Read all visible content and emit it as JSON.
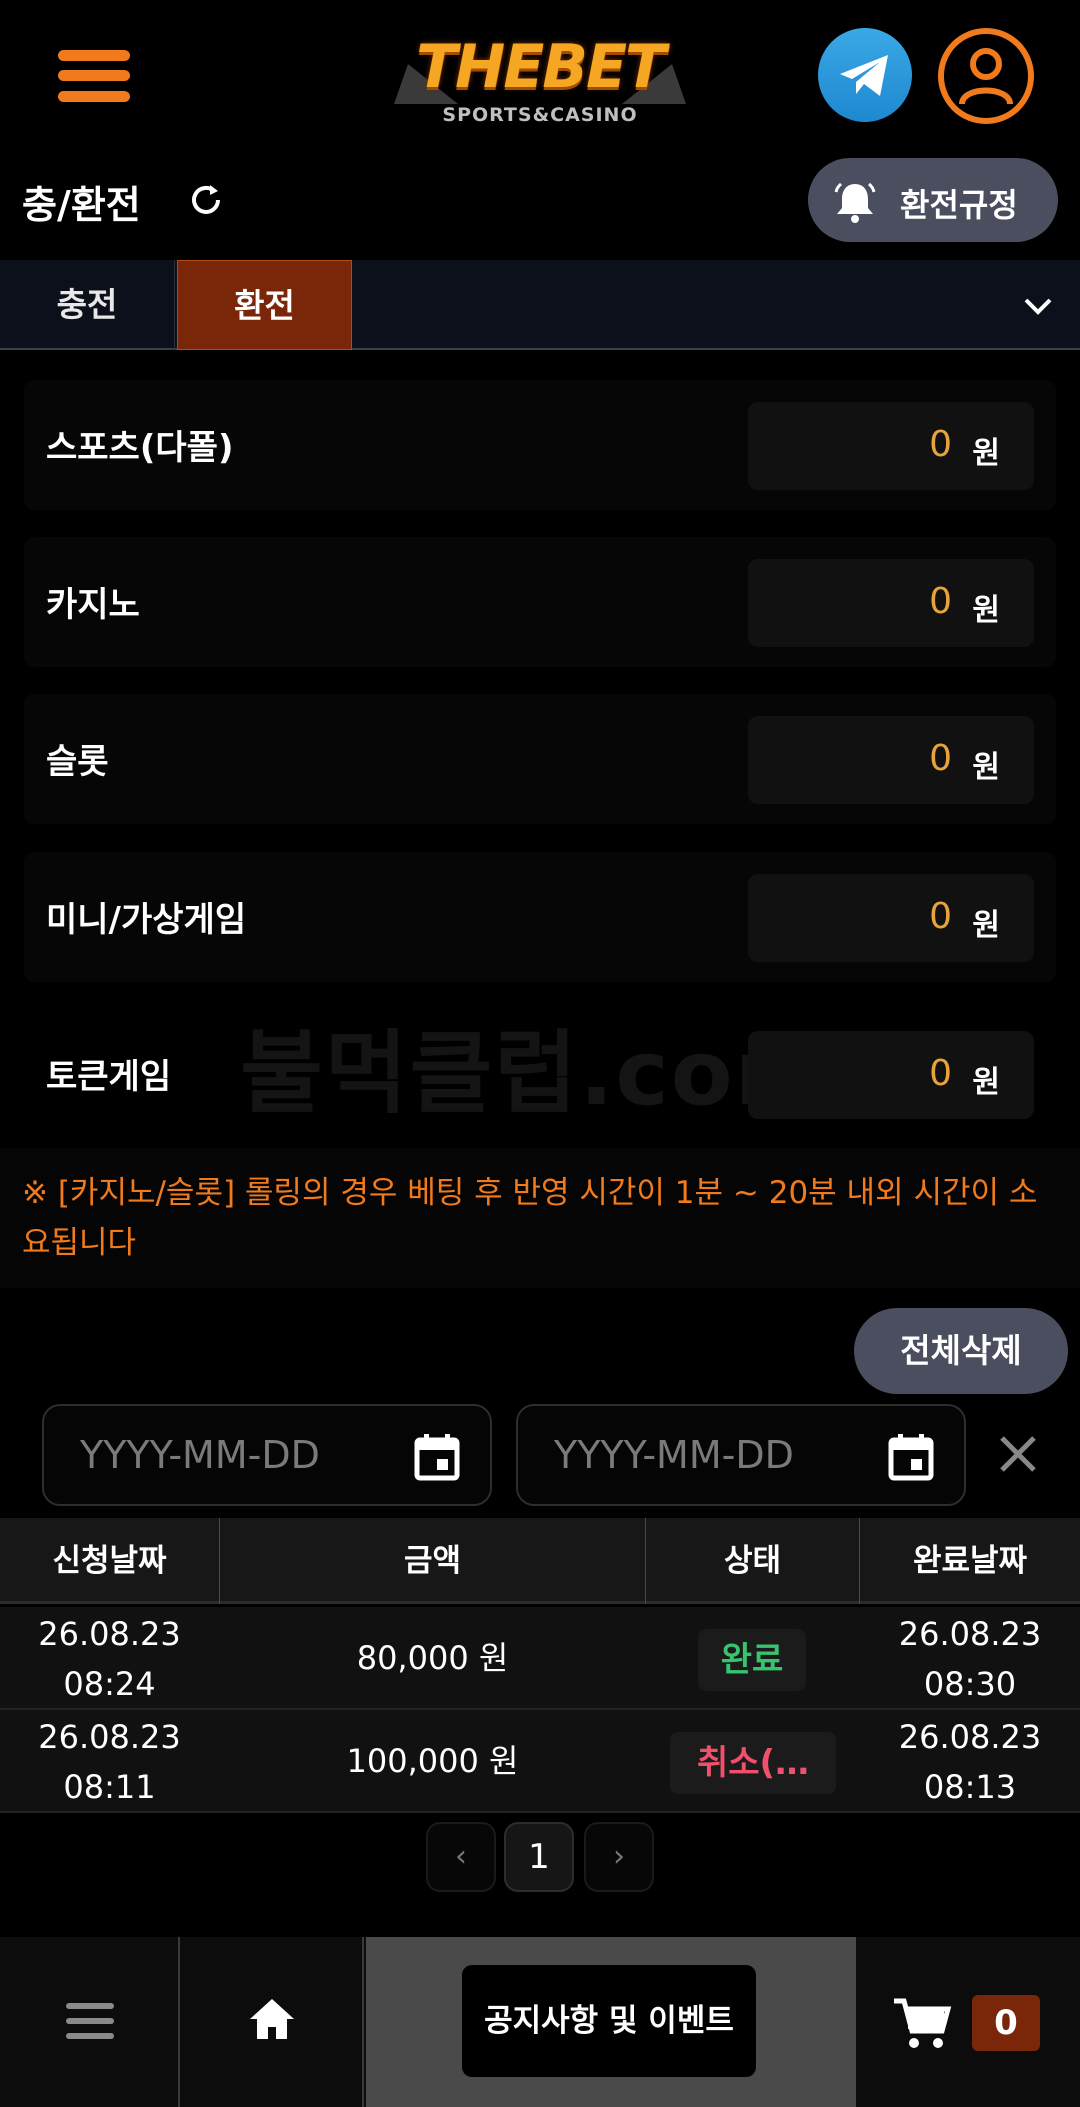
{
  "header": {
    "logo_main": "THEBET",
    "logo_sub": "SPORTS&CASINO"
  },
  "title_row": {
    "title": "충/환전",
    "rules_button": "환전규정"
  },
  "tabs": [
    {
      "label": "충전",
      "active": false
    },
    {
      "label": "환전",
      "active": true
    }
  ],
  "balances": [
    {
      "label": "스포츠(다폴)",
      "value": "0",
      "unit": "원"
    },
    {
      "label": "카지노",
      "value": "0",
      "unit": "원"
    },
    {
      "label": "슬롯",
      "value": "0",
      "unit": "원"
    },
    {
      "label": "미니/가상게임",
      "value": "0",
      "unit": "원"
    },
    {
      "label": "토큰게임",
      "value": "0",
      "unit": "원"
    }
  ],
  "watermark": "불먹클럽.com",
  "notice": "※ [카지노/슬롯] 롤링의 경우 베팅 후 반영 시간이 1분 ~ 20분 내외 시간이 소요됩니다",
  "delete_all": "전체삭제",
  "date_filter": {
    "start_placeholder": "YYYY-MM-DD",
    "end_placeholder": "YYYY-MM-DD"
  },
  "table": {
    "headers": [
      "신청날짜",
      "금액",
      "상태",
      "완료날짜"
    ],
    "rows": [
      {
        "req_date": "26.08.23",
        "req_time": "08:24",
        "amount": "80,000 원",
        "status": "완료",
        "done_date": "26.08.23",
        "done_time": "08:30"
      },
      {
        "req_date": "26.08.23",
        "req_time": "08:11",
        "amount": "100,000 원",
        "status": "취소(…",
        "done_date": "26.08.23",
        "done_time": "08:13"
      }
    ]
  },
  "pagination": {
    "prev": "‹",
    "page": "1",
    "next": "›"
  },
  "bottom_nav": {
    "notice_button": "공지사항 및 이벤트",
    "cart_count": "0"
  },
  "colors": {
    "accent_orange": "#f07a1c",
    "active_tab": "#7a2608",
    "balance_value": "#e8a43a",
    "status_done": "#36c46c",
    "status_cancel": "#f0506a"
  },
  "icons": [
    "hamburger-menu-icon",
    "telegram-icon",
    "user-icon",
    "refresh-icon",
    "bell-icon",
    "chevron-down-icon",
    "calendar-icon",
    "close-icon",
    "home-icon",
    "cart-icon"
  ]
}
